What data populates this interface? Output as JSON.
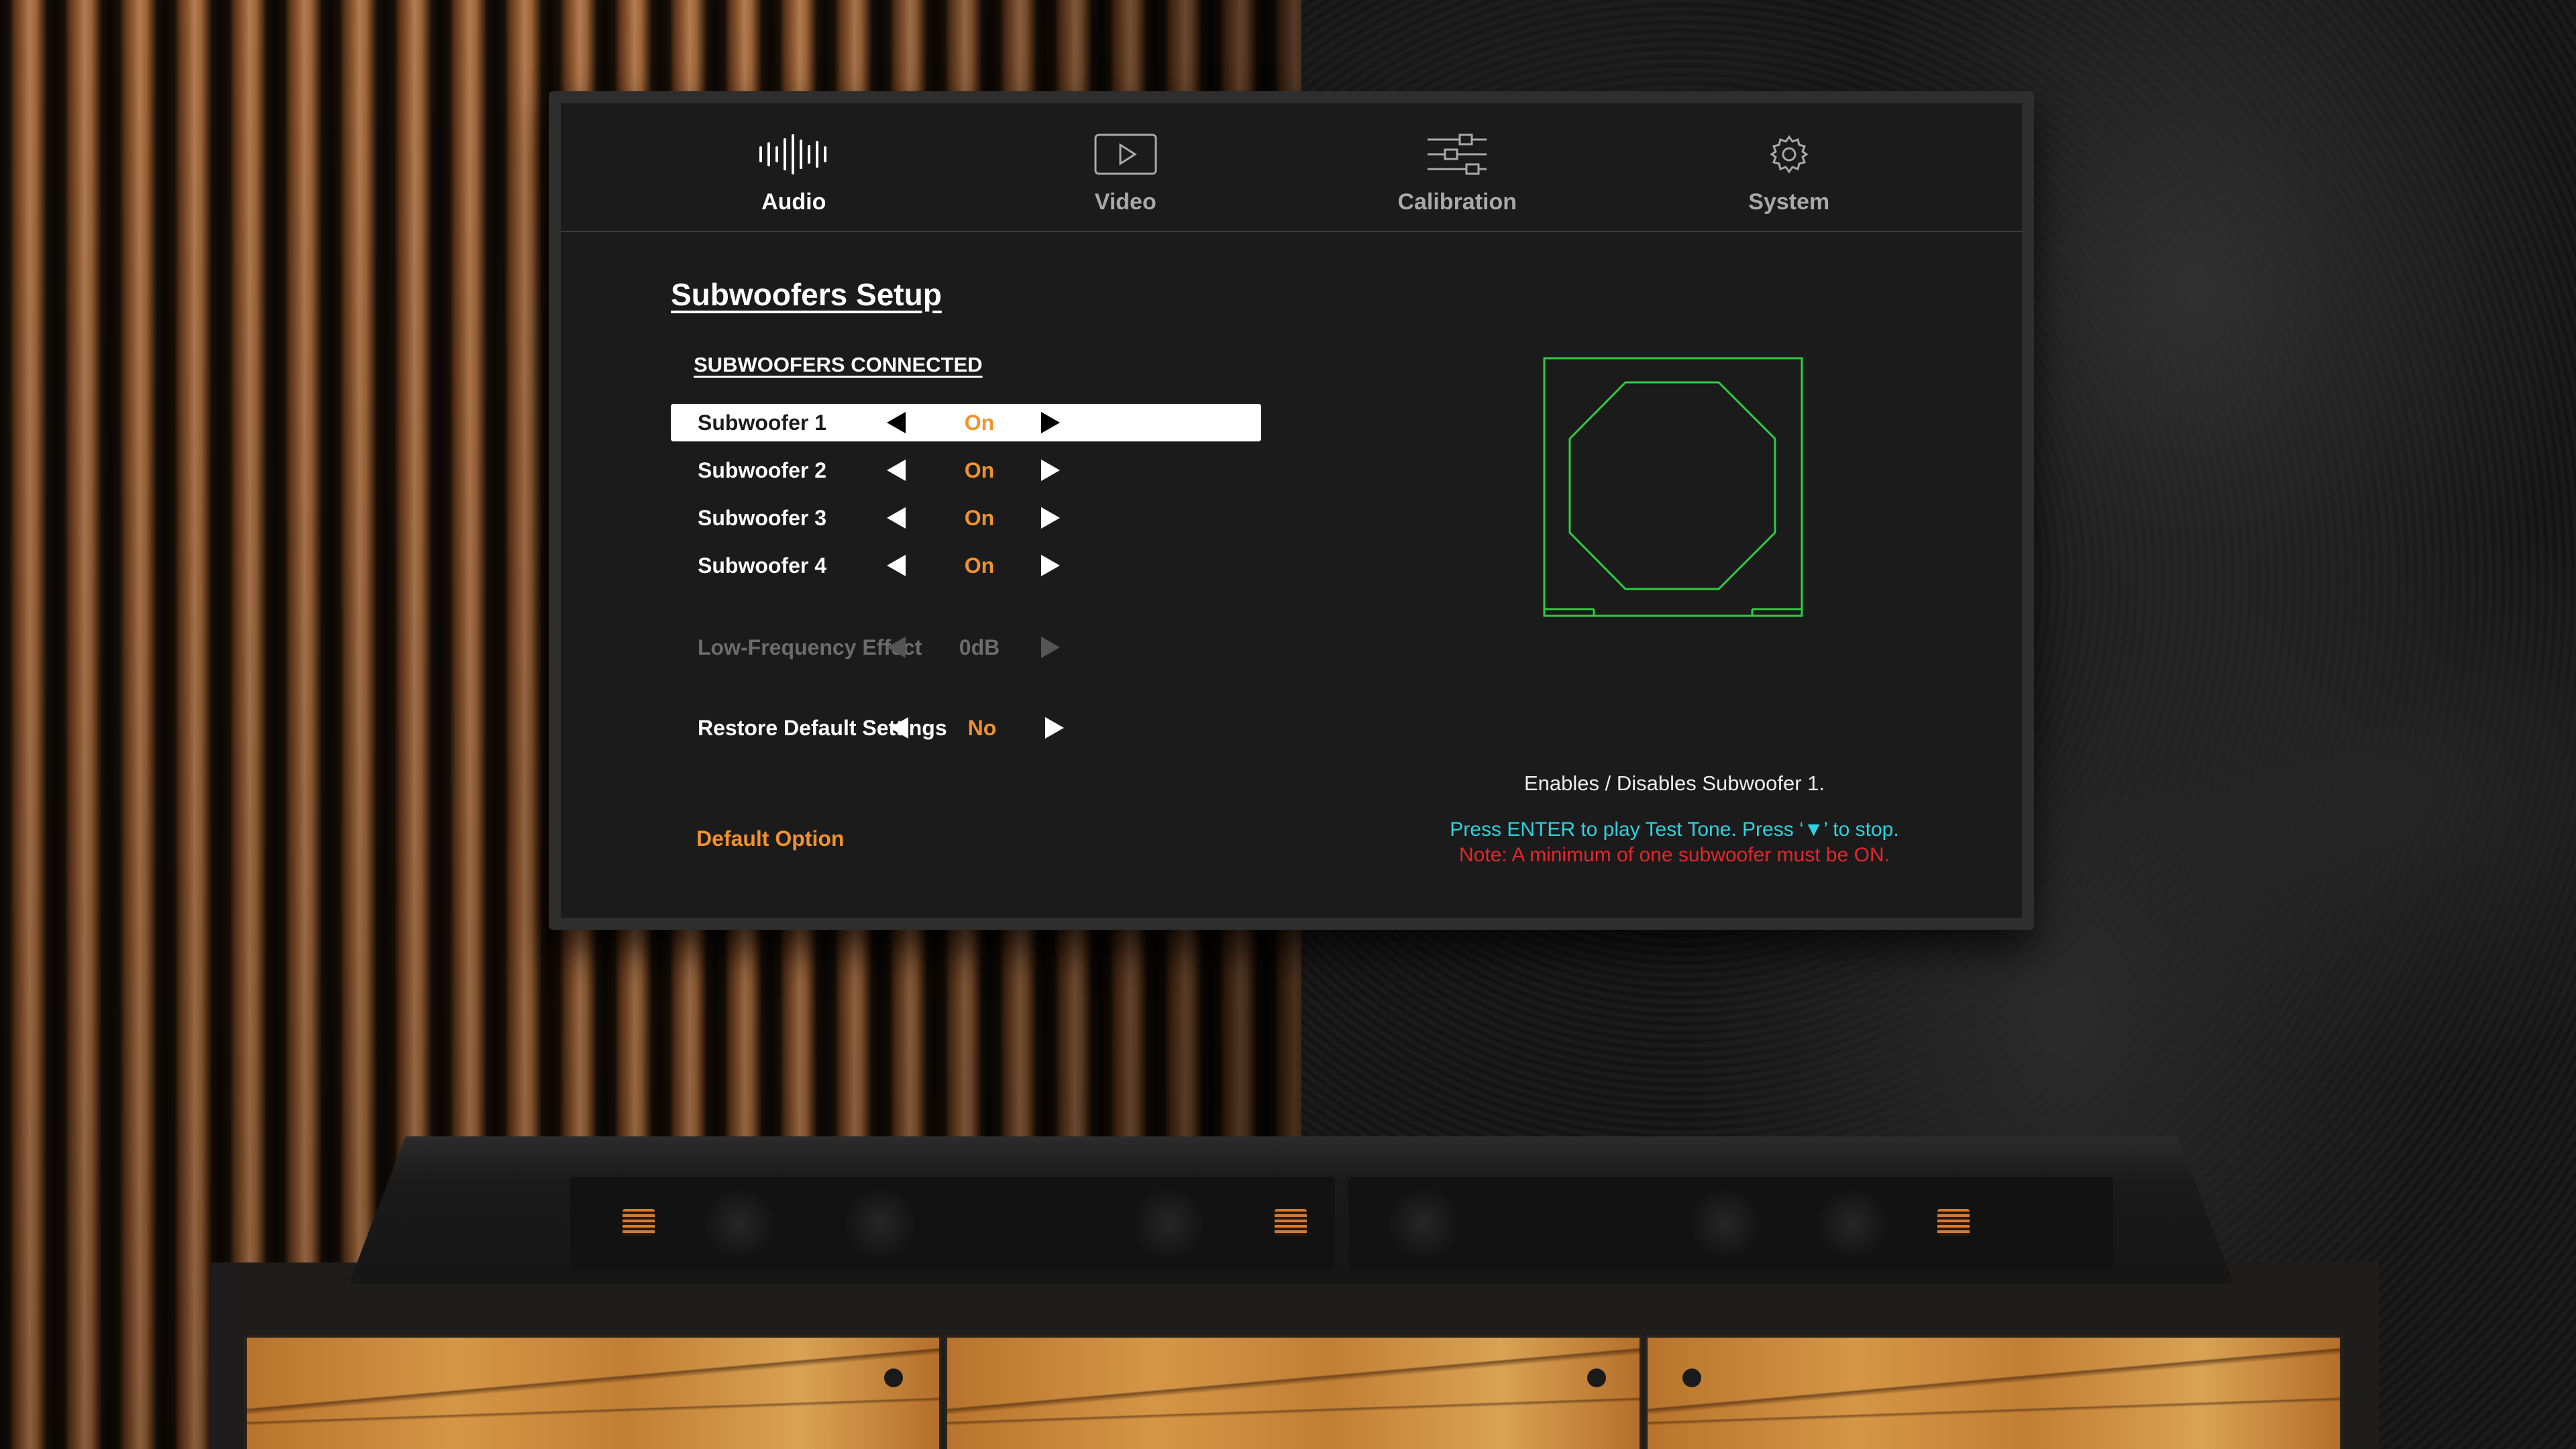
{
  "tabs": [
    {
      "label": "Audio",
      "icon": "audio-waveform-icon",
      "active": true
    },
    {
      "label": "Video",
      "icon": "video-play-icon",
      "active": false
    },
    {
      "label": "Calibration",
      "icon": "sliders-icon",
      "active": false
    },
    {
      "label": "System",
      "icon": "gear-icon",
      "active": false
    }
  ],
  "page": {
    "title": "Subwoofers Setup",
    "section_label": "SUBWOOFERS CONNECTED"
  },
  "settings": {
    "subwoofers": [
      {
        "label": "Subwoofer 1",
        "value": "On",
        "selected": true
      },
      {
        "label": "Subwoofer 2",
        "value": "On",
        "selected": false
      },
      {
        "label": "Subwoofer 3",
        "value": "On",
        "selected": false
      },
      {
        "label": "Subwoofer 4",
        "value": "On",
        "selected": false
      }
    ],
    "lfe": {
      "label": "Low-Frequency Effect",
      "value": "0dB",
      "disabled": true
    },
    "restore": {
      "label": "Restore Default Settings",
      "value": "No"
    }
  },
  "default_option": "Default Option",
  "info": {
    "description": "Enables / Disables Subwoofer 1.",
    "hint_cyan": "Press ENTER to play Test Tone. Press ‘▼’ to stop.",
    "hint_red": "Note: A minimum of one subwoofer must be ON."
  },
  "colors": {
    "accent_orange": "#f0922e",
    "diagram_green": "#2ecc40",
    "hint_cyan": "#2fd3e0",
    "warning_red": "#e4262c",
    "screen_bg": "#1b1b1b"
  }
}
